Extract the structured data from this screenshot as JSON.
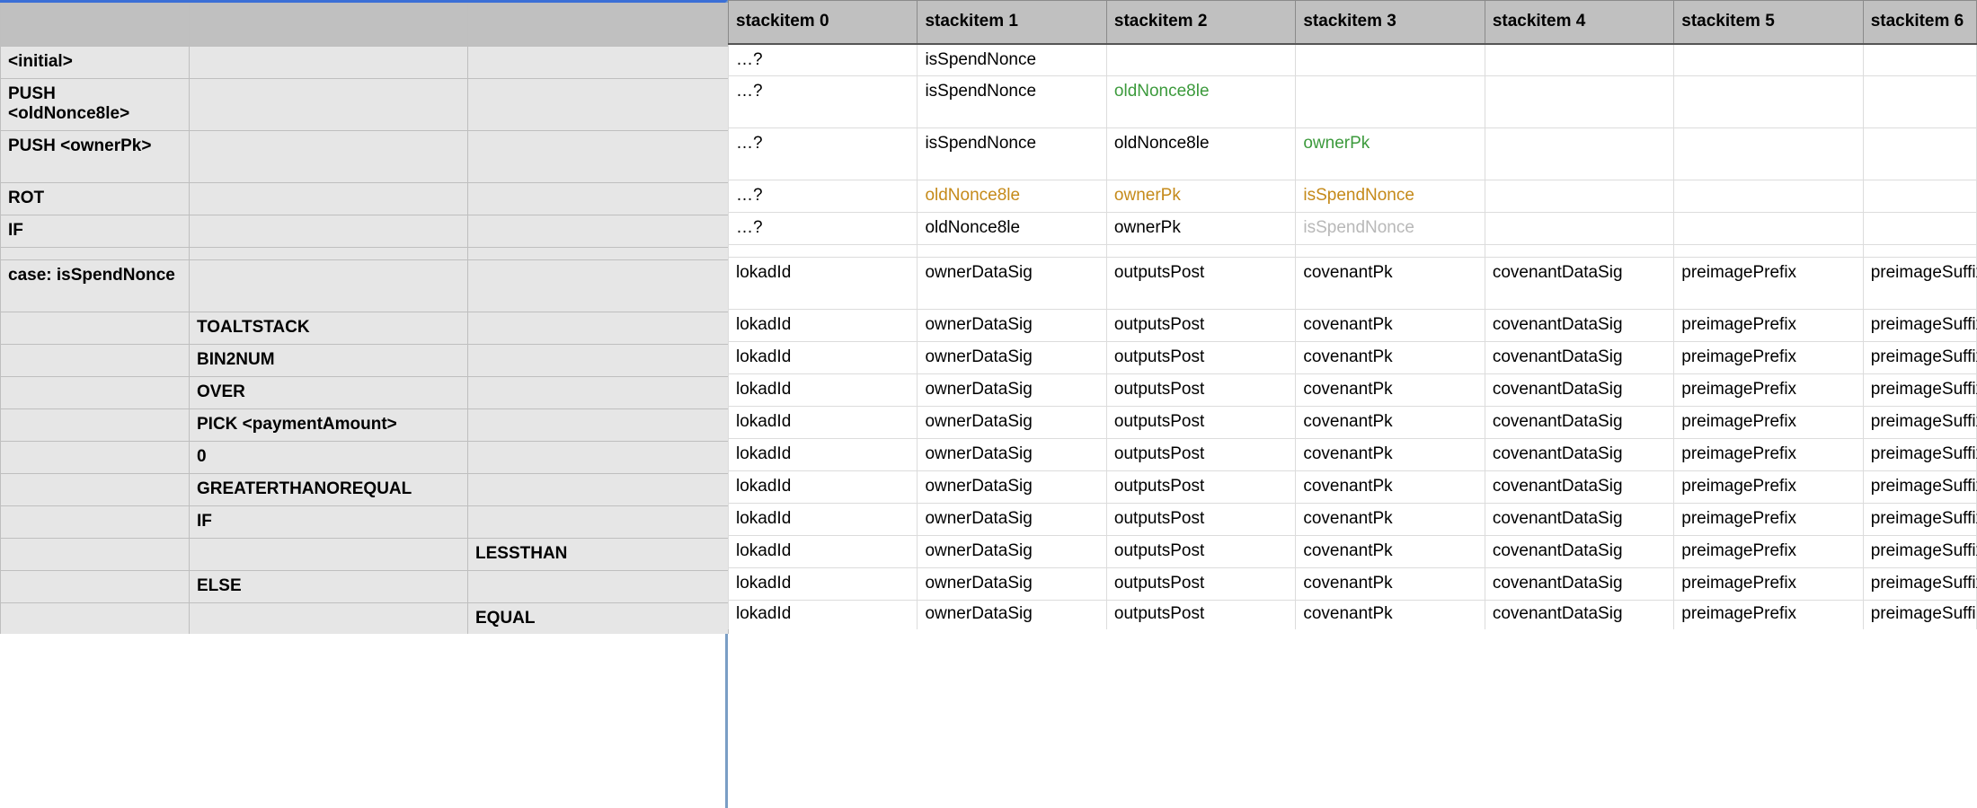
{
  "left_headers": [
    "",
    "",
    ""
  ],
  "right_headers": [
    "stackitem 0",
    "stackitem 1",
    "stackitem 2",
    "stackitem 3",
    "stackitem 4",
    "stackitem 5",
    "stackitem 6"
  ],
  "rows": [
    {
      "left": [
        "<initial>",
        "",
        ""
      ],
      "right": [
        {
          "t": "…?"
        },
        {
          "t": "isSpendNonce"
        },
        {
          "t": ""
        },
        {
          "t": ""
        },
        {
          "t": ""
        },
        {
          "t": ""
        },
        {
          "t": ""
        }
      ],
      "tall": false
    },
    {
      "left": [
        "PUSH <oldNonce8le>",
        "",
        ""
      ],
      "right": [
        {
          "t": "…?"
        },
        {
          "t": "isSpendNonce"
        },
        {
          "t": "oldNonce8le",
          "c": "green"
        },
        {
          "t": ""
        },
        {
          "t": ""
        },
        {
          "t": ""
        },
        {
          "t": ""
        }
      ],
      "tall": true
    },
    {
      "left": [
        "PUSH <ownerPk>",
        "",
        ""
      ],
      "right": [
        {
          "t": "…?"
        },
        {
          "t": "isSpendNonce"
        },
        {
          "t": "oldNonce8le"
        },
        {
          "t": "ownerPk",
          "c": "green"
        },
        {
          "t": ""
        },
        {
          "t": ""
        },
        {
          "t": ""
        }
      ],
      "tall": true
    },
    {
      "left": [
        "ROT",
        "",
        ""
      ],
      "right": [
        {
          "t": "…?"
        },
        {
          "t": "oldNonce8le",
          "c": "orange"
        },
        {
          "t": "ownerPk",
          "c": "orange"
        },
        {
          "t": "isSpendNonce",
          "c": "orange"
        },
        {
          "t": ""
        },
        {
          "t": ""
        },
        {
          "t": ""
        }
      ],
      "tall": false
    },
    {
      "left": [
        "IF",
        "",
        ""
      ],
      "right": [
        {
          "t": "…?"
        },
        {
          "t": "oldNonce8le"
        },
        {
          "t": "ownerPk"
        },
        {
          "t": "isSpendNonce",
          "c": "gray"
        },
        {
          "t": ""
        },
        {
          "t": ""
        },
        {
          "t": ""
        }
      ],
      "tall": false
    },
    {
      "spacer": true
    },
    {
      "left": [
        "case: isSpendNonce",
        "",
        ""
      ],
      "right": [
        {
          "t": "lokadId"
        },
        {
          "t": "ownerDataSig"
        },
        {
          "t": "outputsPost"
        },
        {
          "t": "covenantPk"
        },
        {
          "t": "covenantDataSig"
        },
        {
          "t": "preimagePrefix"
        },
        {
          "t": "preimageSuffix"
        }
      ],
      "tall": true
    },
    {
      "left": [
        "",
        "TOALTSTACK",
        ""
      ],
      "right": [
        {
          "t": "lokadId"
        },
        {
          "t": "ownerDataSig"
        },
        {
          "t": "outputsPost"
        },
        {
          "t": "covenantPk"
        },
        {
          "t": "covenantDataSig"
        },
        {
          "t": "preimagePrefix"
        },
        {
          "t": "preimageSuffix"
        }
      ]
    },
    {
      "left": [
        "",
        "BIN2NUM",
        ""
      ],
      "right": [
        {
          "t": "lokadId"
        },
        {
          "t": "ownerDataSig"
        },
        {
          "t": "outputsPost"
        },
        {
          "t": "covenantPk"
        },
        {
          "t": "covenantDataSig"
        },
        {
          "t": "preimagePrefix"
        },
        {
          "t": "preimageSuffix"
        }
      ]
    },
    {
      "left": [
        "",
        "OVER",
        ""
      ],
      "right": [
        {
          "t": "lokadId"
        },
        {
          "t": "ownerDataSig"
        },
        {
          "t": "outputsPost"
        },
        {
          "t": "covenantPk"
        },
        {
          "t": "covenantDataSig"
        },
        {
          "t": "preimagePrefix"
        },
        {
          "t": "preimageSuffix"
        }
      ]
    },
    {
      "left": [
        "",
        "PICK <paymentAmount>",
        ""
      ],
      "right": [
        {
          "t": "lokadId"
        },
        {
          "t": "ownerDataSig"
        },
        {
          "t": "outputsPost"
        },
        {
          "t": "covenantPk"
        },
        {
          "t": "covenantDataSig"
        },
        {
          "t": "preimagePrefix"
        },
        {
          "t": "preimageSuffix"
        }
      ]
    },
    {
      "left": [
        "",
        "0",
        ""
      ],
      "right": [
        {
          "t": "lokadId"
        },
        {
          "t": "ownerDataSig"
        },
        {
          "t": "outputsPost"
        },
        {
          "t": "covenantPk"
        },
        {
          "t": "covenantDataSig"
        },
        {
          "t": "preimagePrefix"
        },
        {
          "t": "preimageSuffix"
        }
      ]
    },
    {
      "left": [
        "",
        "GREATERTHANOREQUAL",
        ""
      ],
      "right": [
        {
          "t": "lokadId"
        },
        {
          "t": "ownerDataSig"
        },
        {
          "t": "outputsPost"
        },
        {
          "t": "covenantPk"
        },
        {
          "t": "covenantDataSig"
        },
        {
          "t": "preimagePrefix"
        },
        {
          "t": "preimageSuffix"
        }
      ]
    },
    {
      "left": [
        "",
        "IF",
        ""
      ],
      "right": [
        {
          "t": "lokadId"
        },
        {
          "t": "ownerDataSig"
        },
        {
          "t": "outputsPost"
        },
        {
          "t": "covenantPk"
        },
        {
          "t": "covenantDataSig"
        },
        {
          "t": "preimagePrefix"
        },
        {
          "t": "preimageSuffix"
        }
      ]
    },
    {
      "left": [
        "",
        "",
        "LESSTHAN"
      ],
      "right": [
        {
          "t": "lokadId"
        },
        {
          "t": "ownerDataSig"
        },
        {
          "t": "outputsPost"
        },
        {
          "t": "covenantPk"
        },
        {
          "t": "covenantDataSig"
        },
        {
          "t": "preimagePrefix"
        },
        {
          "t": "preimageSuffix"
        }
      ]
    },
    {
      "left": [
        "",
        "ELSE",
        ""
      ],
      "right": [
        {
          "t": "lokadId"
        },
        {
          "t": "ownerDataSig"
        },
        {
          "t": "outputsPost"
        },
        {
          "t": "covenantPk"
        },
        {
          "t": "covenantDataSig"
        },
        {
          "t": "preimagePrefix"
        },
        {
          "t": "preimageSuffix"
        }
      ]
    },
    {
      "left": [
        "",
        "",
        "EQUAL"
      ],
      "right": [
        {
          "t": "lokadId"
        },
        {
          "t": "ownerDataSig"
        },
        {
          "t": "outputsPost"
        },
        {
          "t": "covenantPk"
        },
        {
          "t": "covenantDataSig"
        },
        {
          "t": "preimagePrefix"
        },
        {
          "t": "preimageSuffix"
        }
      ],
      "cut": true
    }
  ]
}
